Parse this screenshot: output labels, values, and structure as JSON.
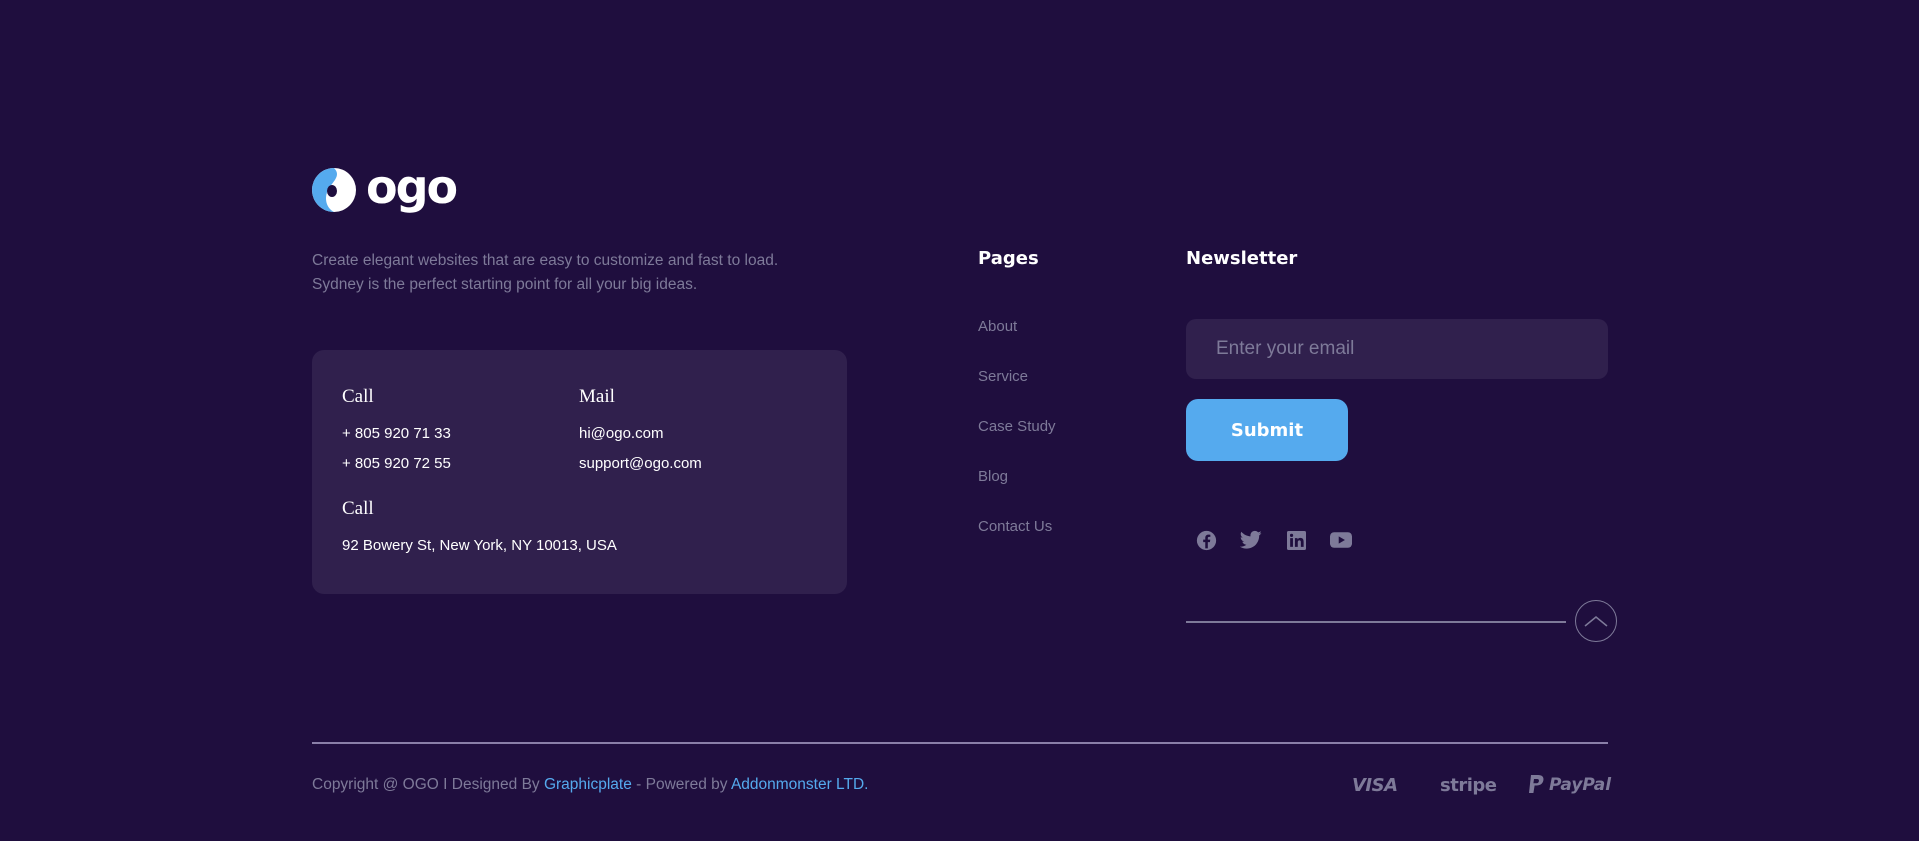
{
  "brand": {
    "logo_text": "ogo",
    "tagline_line1": "Create elegant websites that are easy to customize and fast to load.",
    "tagline_line2": "Sydney is the perfect starting point for all your big ideas."
  },
  "contact": {
    "call_heading": "Call",
    "phone1": "+ 805 920 71 33",
    "phone2": "+ 805 920 72 55",
    "mail_heading": "Mail",
    "email1": "hi@ogo.com",
    "email2": "support@ogo.com",
    "address_heading": "Call",
    "address": "92 Bowery St, New York, NY 10013, USA"
  },
  "pages": {
    "heading": "Pages",
    "links": [
      "About",
      "Service",
      "Case Study",
      "Blog",
      "Contact Us"
    ]
  },
  "newsletter": {
    "heading": "Newsletter",
    "email_placeholder": "Enter your email",
    "submit_label": "Submit"
  },
  "social_icons": [
    "facebook-icon",
    "twitter-icon",
    "linkedin-icon",
    "youtube-icon"
  ],
  "copyright": {
    "prefix": "Copyright @ OGO I Designed By ",
    "designer": "Graphicplate",
    "middle": " - Powered by ",
    "powered_by": "Addonmonster LTD."
  },
  "payments": {
    "visa": "VISA",
    "stripe": "stripe",
    "paypal": "PayPal"
  },
  "colors": {
    "background": "#1f0e3e",
    "card": "#30204d",
    "accent": "#55aaee",
    "muted_text": "#7e7a99"
  }
}
